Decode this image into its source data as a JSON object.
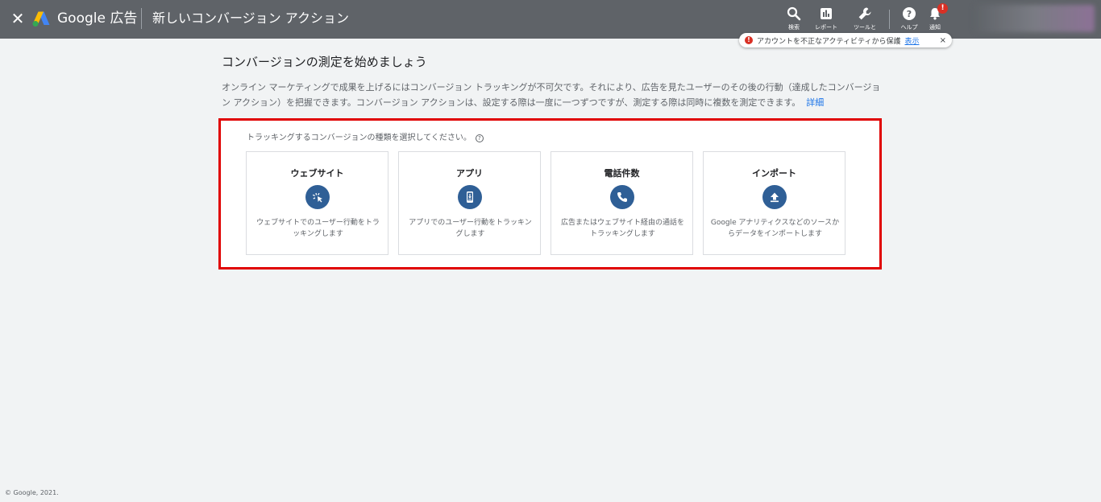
{
  "header": {
    "brand": "Google 広告",
    "page_title": "新しいコンバージョン アクション",
    "tools": [
      {
        "label": "検索",
        "icon": "search-icon"
      },
      {
        "label": "レポート",
        "icon": "reports-icon"
      },
      {
        "label": "ツールと",
        "icon": "wrench-icon"
      },
      {
        "label": "ヘルプ",
        "icon": "help-icon"
      },
      {
        "label": "通知",
        "icon": "bell-icon",
        "badge": "!"
      }
    ]
  },
  "alert": {
    "text": "アカウントを不正なアクティビティから保護",
    "link": "表示",
    "close": "×",
    "icon_char": "!"
  },
  "main": {
    "heading": "コンバージョンの測定を始めましょう",
    "description": "オンライン マーケティングで成果を上げるにはコンバージョン トラッキングが不可欠です。それにより、広告を見たユーザーのその後の行動（達成したコンバージョン アクション）を把握できます。コンバージョン アクションは、設定する際は一度に一つずつですが、測定する際は同時に複数を測定できます。",
    "learn_more": "詳細",
    "prompt": "トラッキングするコンバージョンの種類を選択してください。",
    "help_char": "?",
    "cards": [
      {
        "title": "ウェブサイト",
        "icon": "cursor-click-icon",
        "desc": "ウェブサイトでのユーザー行動をトラッキングします"
      },
      {
        "title": "アプリ",
        "icon": "mobile-download-icon",
        "desc": "アプリでのユーザー行動をトラッキングします"
      },
      {
        "title": "電話件数",
        "icon": "phone-icon",
        "desc": "広告またはウェブサイト経由の通話をトラッキングします"
      },
      {
        "title": "インポート",
        "icon": "upload-icon",
        "desc": "Google アナリティクスなどのソースからデータをインポートします"
      }
    ]
  },
  "footer": {
    "copyright": "© Google, 2021."
  },
  "colors": {
    "topbar": "#5f6368",
    "accent_blue": "#1a73e8",
    "icon_circle": "#2f5f96",
    "highlight_border": "#e00000",
    "alert_red": "#d93025"
  }
}
